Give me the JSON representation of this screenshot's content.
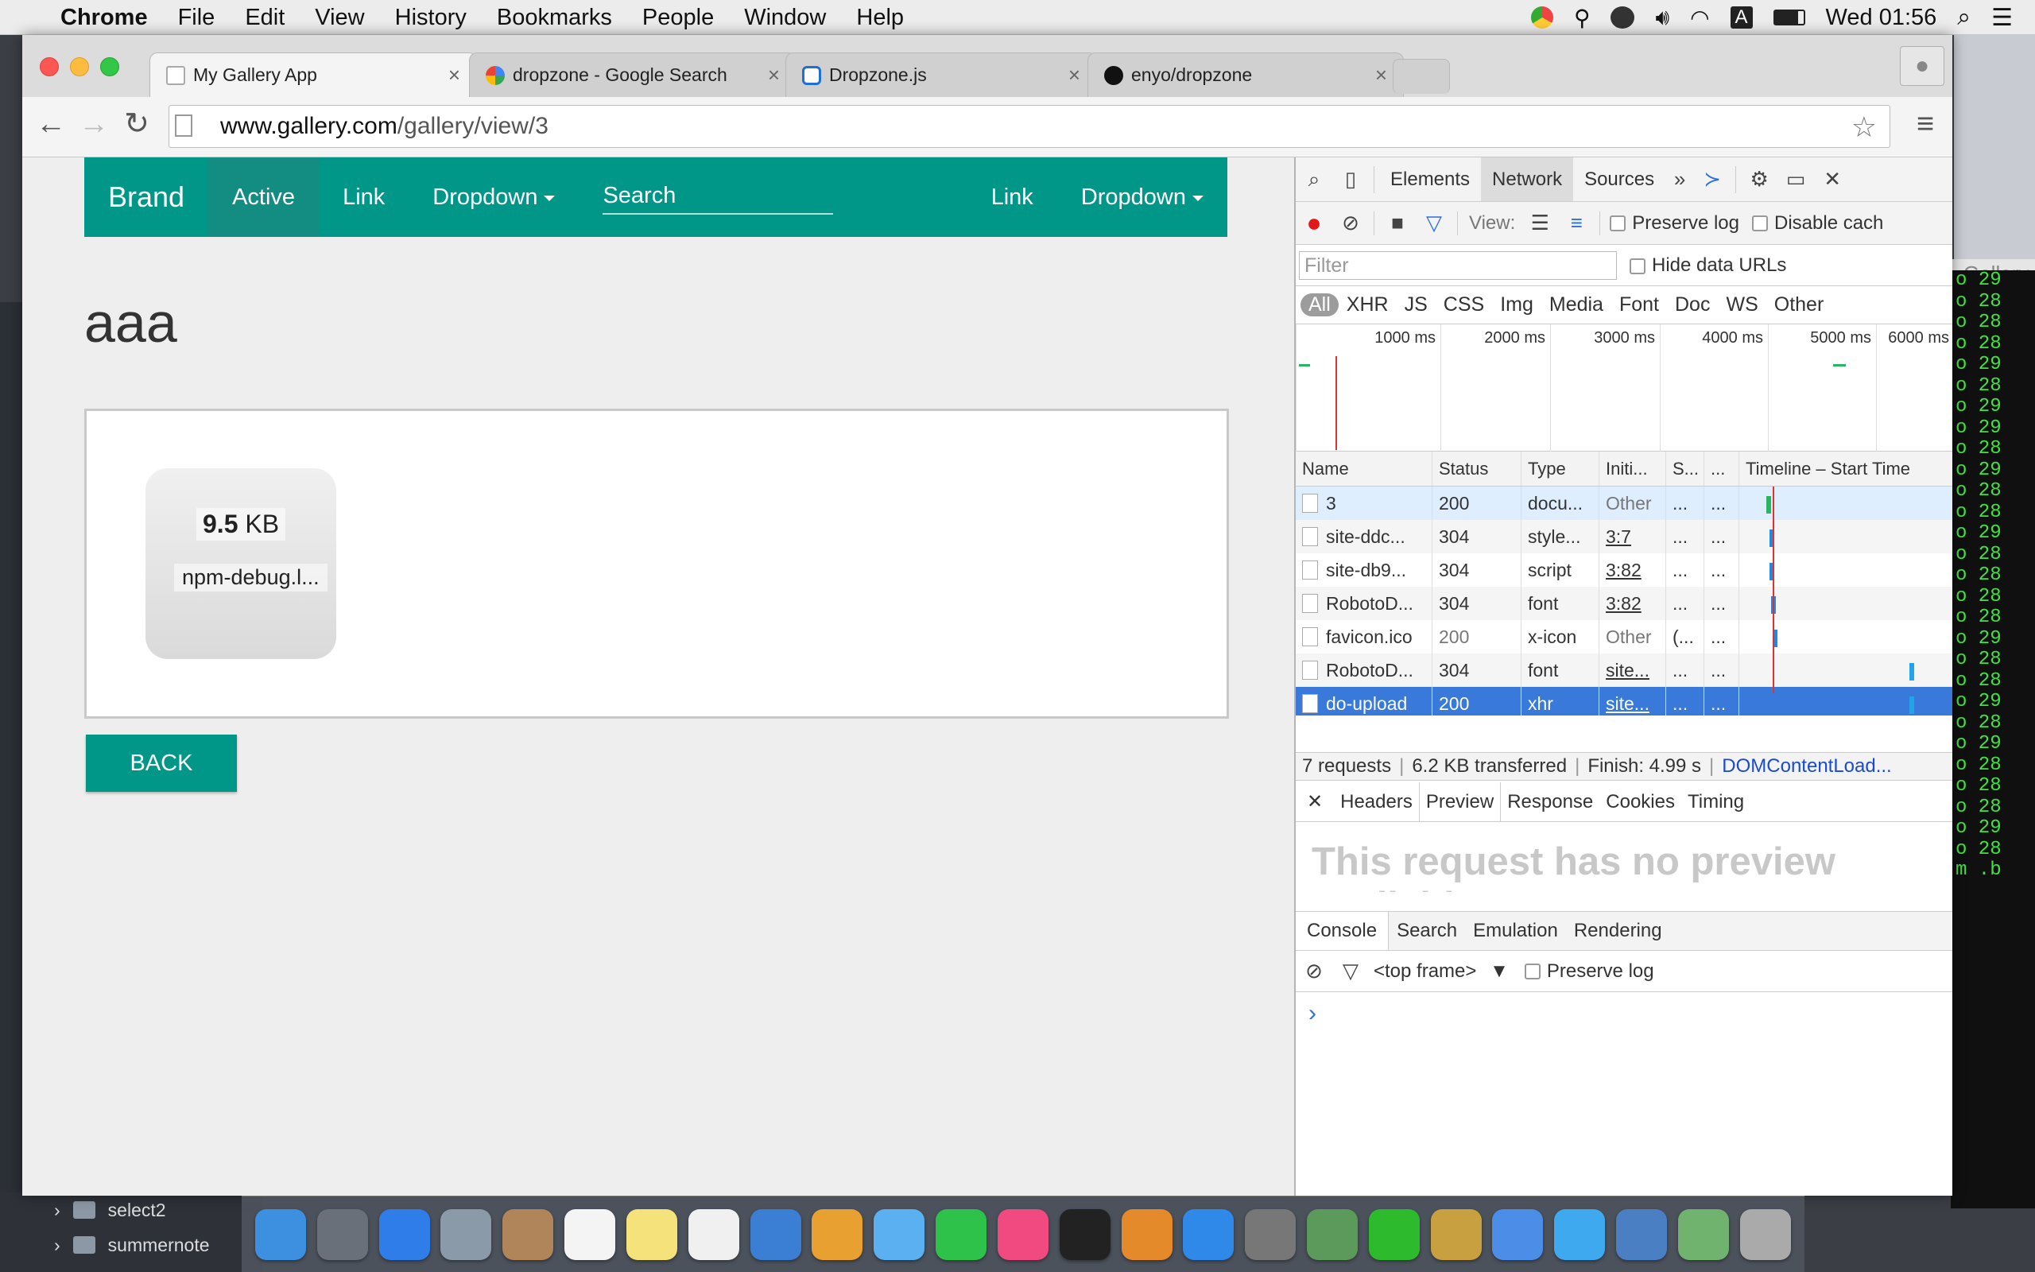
{
  "menubar": {
    "apple": "",
    "app": "Chrome",
    "items": [
      "File",
      "Edit",
      "View",
      "History",
      "Bookmarks",
      "People",
      "Window",
      "Help"
    ],
    "input_source": "A",
    "clock": "Wed 01:56"
  },
  "browser": {
    "tabs": [
      {
        "title": "My Gallery App",
        "active": true
      },
      {
        "title": "dropzone - Google Search",
        "active": false
      },
      {
        "title": "Dropzone.js",
        "active": false
      },
      {
        "title": "enyo/dropzone",
        "active": false
      }
    ],
    "url_host": "www.gallery.com",
    "url_path": "/gallery/view/3"
  },
  "page": {
    "navbar": {
      "brand": "Brand",
      "active": "Active",
      "link": "Link",
      "dropdown": "Dropdown",
      "search_placeholder": "Search",
      "right_link": "Link",
      "right_dropdown": "Dropdown"
    },
    "title": "aaa",
    "file": {
      "size_value": "9.5",
      "size_unit": "KB",
      "name": "npm-debug.l..."
    },
    "back_label": "BACK"
  },
  "devtools": {
    "tabs": [
      "Elements",
      "Network",
      "Sources"
    ],
    "selected_tab": "Network",
    "view_label": "View:",
    "preserve_log": "Preserve log",
    "disable_cache": "Disable cach",
    "filter_placeholder": "Filter",
    "hide_data_urls": "Hide data URLs",
    "type_filters": [
      "All",
      "XHR",
      "JS",
      "CSS",
      "Img",
      "Media",
      "Font",
      "Doc",
      "WS",
      "Other"
    ],
    "overview_ticks": [
      "1000 ms",
      "2000 ms",
      "3000 ms",
      "4000 ms",
      "5000 ms",
      "6000 ms"
    ],
    "columns": [
      "Name",
      "Status",
      "Type",
      "Initi...",
      "S...",
      "...",
      "Timeline – Start Time"
    ],
    "requests": [
      {
        "name": "3",
        "status": "200",
        "type": "docu...",
        "initiator": "Other",
        "size": "...",
        "time": "..."
      },
      {
        "name": "site-ddc...",
        "status": "304",
        "type": "style...",
        "initiator": "3:7",
        "size": "...",
        "time": "..."
      },
      {
        "name": "site-db9...",
        "status": "304",
        "type": "script",
        "initiator": "3:82",
        "size": "...",
        "time": "..."
      },
      {
        "name": "RobotoD...",
        "status": "304",
        "type": "font",
        "initiator": "3:82",
        "size": "...",
        "time": "..."
      },
      {
        "name": "favicon.ico",
        "status": "200",
        "type": "x-icon",
        "initiator": "Other",
        "size": "(...",
        "time": "..."
      },
      {
        "name": "RobotoD...",
        "status": "304",
        "type": "font",
        "initiator": "site...",
        "size": "...",
        "time": "..."
      },
      {
        "name": "do-upload",
        "status": "200",
        "type": "xhr",
        "initiator": "site...",
        "size": "...",
        "time": "..."
      }
    ],
    "summary": {
      "requests": "7 requests",
      "transferred": "6.2 KB transferred",
      "finish": "Finish: 4.99 s",
      "dcl": "DOMContentLoad..."
    },
    "detail_tabs": [
      "Headers",
      "Preview",
      "Response",
      "Cookies",
      "Timing"
    ],
    "selected_detail": "Preview",
    "no_preview": "This request has no preview available",
    "drawer_tabs": [
      "Console",
      "Search",
      "Emulation",
      "Rendering"
    ],
    "frame": "<top frame>",
    "console_preserve": "Preserve log",
    "prompt": "›"
  },
  "background": {
    "gallery_tab": "Gallery",
    "terminal_lines": [
      "o 29",
      "o 28",
      "o 28",
      "o 28",
      "o 29",
      "o 28",
      "o 29",
      "o 29",
      "o 28",
      "o 29",
      "o 28",
      "o 28",
      "o 29",
      "o 28",
      "o 28",
      "o 28",
      "o 28",
      "o 29",
      "o 28",
      "o 28",
      "o 29",
      "o 28",
      "o 29",
      "o 28",
      "o 28",
      "o 28",
      "o 29",
      "o 28",
      "m .b"
    ],
    "finder_items": [
      "select2",
      "summernote"
    ]
  },
  "colors": {
    "accent": "#009688",
    "selection": "#3879d9",
    "terminal": "#3fe33f"
  }
}
